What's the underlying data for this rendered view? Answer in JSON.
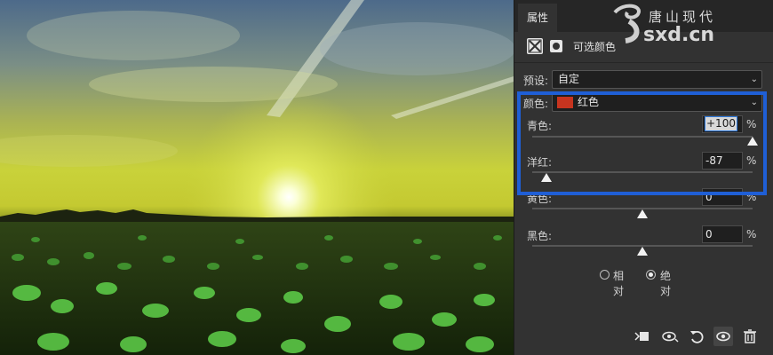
{
  "panel": {
    "tab_label": "属性",
    "adjustment_title": "可选颜色",
    "preset_label": "预设:",
    "preset_value": "自定",
    "color_label": "颜色:",
    "color_value": "红色",
    "color_swatch": "#c7341f",
    "sliders": [
      {
        "label": "青色:",
        "value": "+100",
        "level": 100,
        "selected": true
      },
      {
        "label": "洋红:",
        "value": "-87",
        "level": -87,
        "selected": false
      },
      {
        "label": "黄色:",
        "value": "0",
        "level": 0,
        "selected": false
      },
      {
        "label": "黑色:",
        "value": "0",
        "level": 0,
        "selected": false
      }
    ],
    "percent": "%",
    "method_relative": "相对",
    "method_absolute": "绝对",
    "method_selected": "absolute"
  },
  "watermark": {
    "text": "唐山现代",
    "domain": "sxd.cn"
  },
  "footer_icons": [
    "clip-to-layer-icon",
    "view-previous-icon",
    "reset-icon",
    "visibility-icon",
    "trash-icon"
  ],
  "colors": {
    "highlight": "#1f5fd6",
    "panel_bg": "#323232"
  }
}
